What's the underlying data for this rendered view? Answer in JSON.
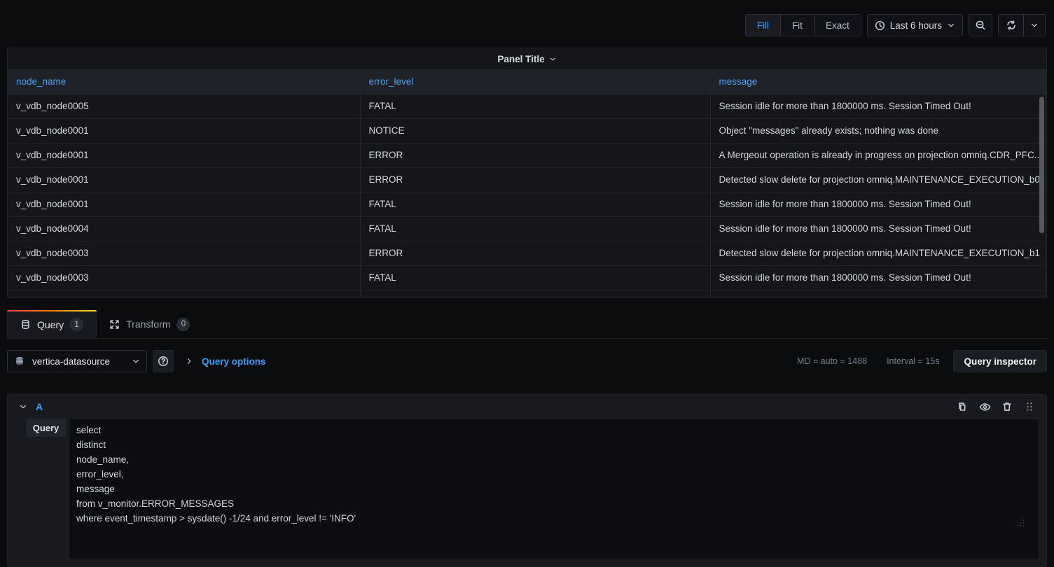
{
  "toolbar": {
    "panel_fit_options": [
      {
        "label": "Fill",
        "active": true
      },
      {
        "label": "Fit",
        "active": false
      },
      {
        "label": "Exact",
        "active": false
      }
    ],
    "time_range": "Last 6 hours",
    "icons": {
      "clock": "clock-icon",
      "time_caret": "chevron-down-icon",
      "zoom_out": "zoom-out-icon",
      "refresh": "refresh-icon",
      "refresh_caret": "chevron-down-icon"
    }
  },
  "panel": {
    "title": "Panel Title",
    "title_caret": "chevron-down-icon",
    "table": {
      "columns": [
        "node_name",
        "error_level",
        "message"
      ],
      "rows": [
        [
          "v_vdb_node0005",
          "FATAL",
          "Session idle for more than 1800000 ms. Session Timed Out!"
        ],
        [
          "v_vdb_node0001",
          "NOTICE",
          "Object \"messages\" already exists; nothing was done"
        ],
        [
          "v_vdb_node0001",
          "ERROR",
          "A Mergeout operation is already in progress on projection omniq.CDR_PFC..."
        ],
        [
          "v_vdb_node0001",
          "ERROR",
          "Detected slow delete for projection omniq.MAINTENANCE_EXECUTION_b0"
        ],
        [
          "v_vdb_node0001",
          "FATAL",
          "Session idle for more than 1800000 ms. Session Timed Out!"
        ],
        [
          "v_vdb_node0004",
          "FATAL",
          "Session idle for more than 1800000 ms. Session Timed Out!"
        ],
        [
          "v_vdb_node0003",
          "ERROR",
          "Detected slow delete for projection omniq.MAINTENANCE_EXECUTION_b1"
        ],
        [
          "v_vdb_node0003",
          "FATAL",
          "Session idle for more than 1800000 ms. Session Timed Out!"
        ],
        [
          "",
          "",
          ""
        ]
      ]
    }
  },
  "tabs": [
    {
      "label": "Query",
      "count": "1",
      "icon": "database-icon",
      "active": true
    },
    {
      "label": "Transform",
      "count": "0",
      "icon": "transform-icon",
      "active": false
    }
  ],
  "query_bar": {
    "datasource": "vertica-datasource",
    "datasource_icon": "datasource-icon",
    "datasource_caret": "chevron-down-icon",
    "help_icon": "help-circle-icon",
    "query_options_caret": "chevron-right-icon",
    "query_options_label": "Query options",
    "max_data_points": "MD = auto = 1488",
    "interval": "Interval = 15s",
    "inspector_label": "Query inspector"
  },
  "query_editor": {
    "ref_id": "A",
    "collapse_icon": "chevron-down-icon",
    "actions": [
      {
        "name": "duplicate-query-icon"
      },
      {
        "name": "toggle-query-visibility-icon"
      },
      {
        "name": "remove-query-icon"
      },
      {
        "name": "drag-handle-icon"
      }
    ],
    "field_label": "Query",
    "sql": "select\ndistinct\nnode_name,\nerror_level,\nmessage\nfrom v_monitor.ERROR_MESSAGES\nwhere event_timestamp > sysdate() -1/24 and error_level != 'INFO'"
  },
  "colors": {
    "page_bg": "#0b0c0e",
    "panel_bg": "#141619",
    "header_row_bg": "#1f2228",
    "accent_blue": "#3d9bf5",
    "column_header_blue": "#4d9ff0",
    "tab_gradient_start": "#f2495c",
    "tab_gradient_end": "#fade2a"
  }
}
